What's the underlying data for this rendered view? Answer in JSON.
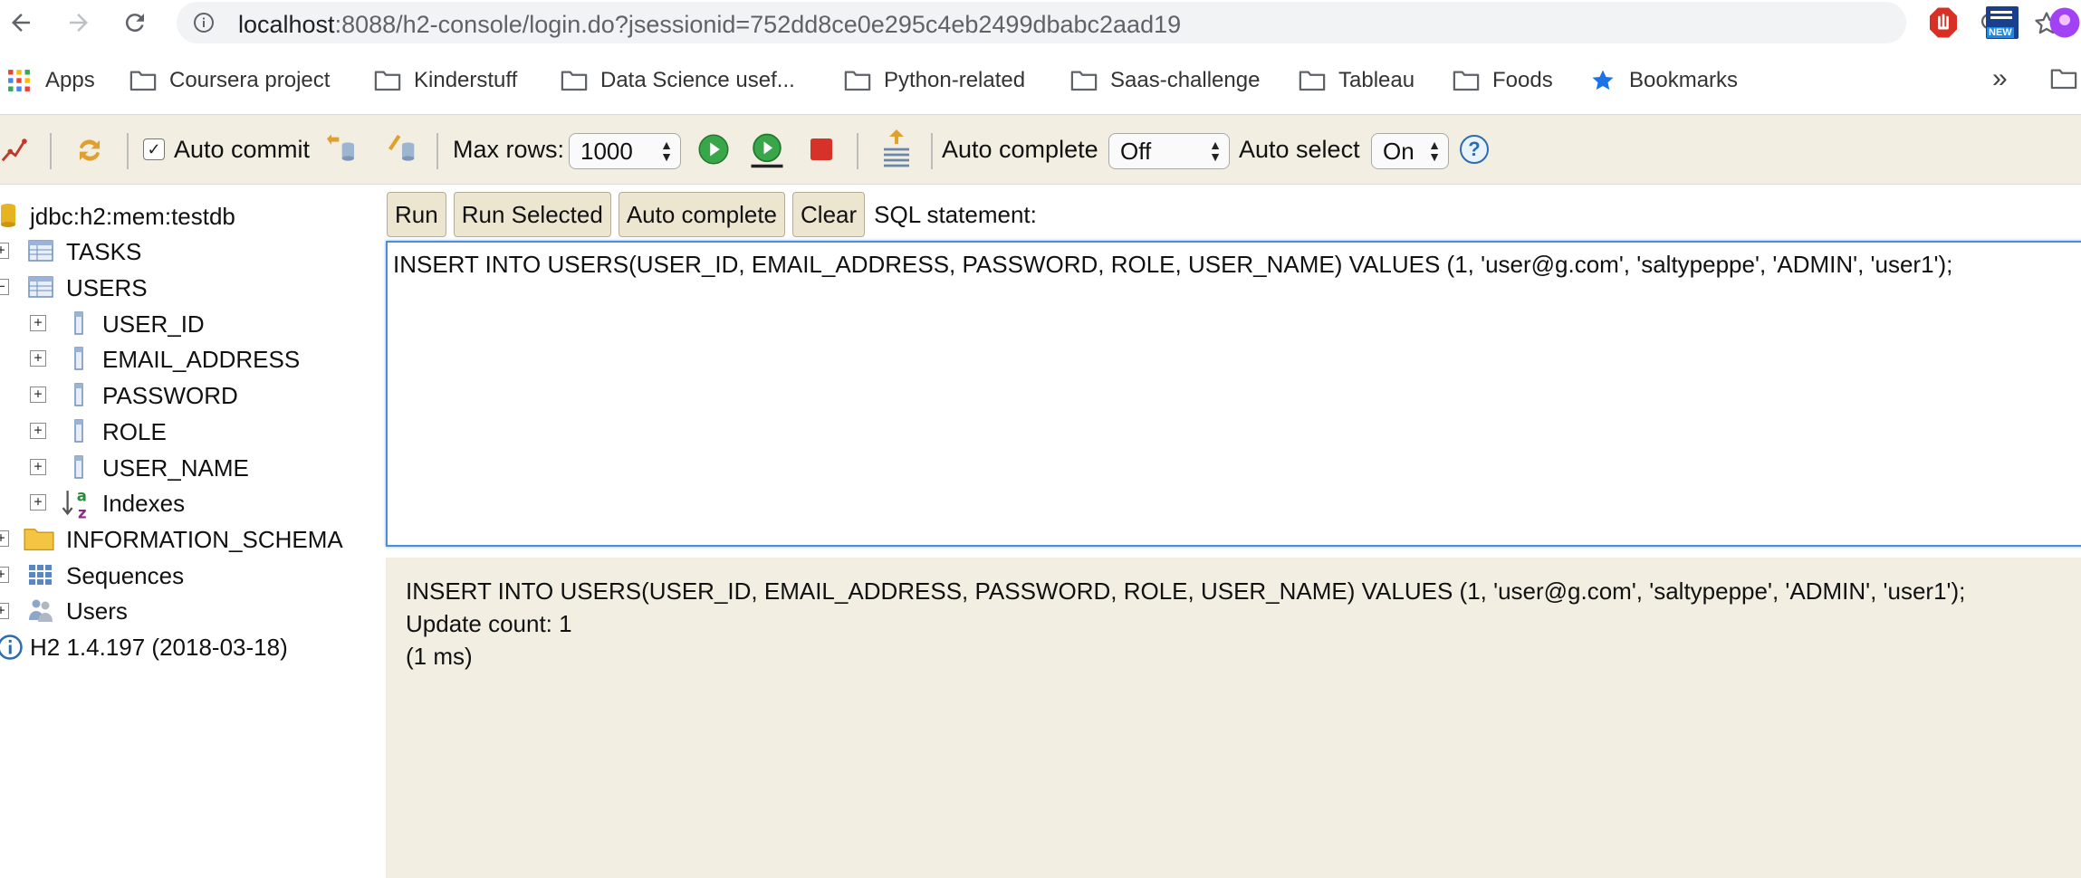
{
  "browser": {
    "url_host": "localhost",
    "url_rest": ":8088/h2-console/login.do?jsessionid=752dd8ce0e295c4eb2499dbabc2aad19",
    "extension_badge": "NEW"
  },
  "bookmarks": [
    {
      "label": "Apps",
      "icon": "apps-grid-icon"
    },
    {
      "label": "Coursera project",
      "icon": "folder-icon"
    },
    {
      "label": "Kinderstuff",
      "icon": "folder-icon"
    },
    {
      "label": "Data Science usef...",
      "icon": "folder-icon"
    },
    {
      "label": "Python-related",
      "icon": "folder-icon"
    },
    {
      "label": "Saas-challenge",
      "icon": "folder-icon"
    },
    {
      "label": "Tableau",
      "icon": "folder-icon"
    },
    {
      "label": "Foods",
      "icon": "folder-icon"
    },
    {
      "label": "Bookmarks",
      "icon": "star-icon"
    }
  ],
  "bookmarks_more": "»",
  "toolbar": {
    "auto_commit_label": "Auto commit",
    "auto_commit_checked": true,
    "max_rows_label": "Max rows:",
    "max_rows_value": "1000",
    "auto_complete_label": "Auto complete",
    "auto_complete_value": "Off",
    "auto_select_label": "Auto select",
    "auto_select_value": "On",
    "help_symbol": "?"
  },
  "tree": {
    "connection": "jdbc:h2:mem:testdb",
    "tables": [
      {
        "name": "TASKS",
        "expanded": false
      },
      {
        "name": "USERS",
        "expanded": true
      }
    ],
    "users_columns": [
      "USER_ID",
      "EMAIL_ADDRESS",
      "PASSWORD",
      "ROLE",
      "USER_NAME"
    ],
    "indexes_label": "Indexes",
    "information_schema": "INFORMATION_SCHEMA",
    "sequences": "Sequences",
    "users": "Users",
    "version": "H2 1.4.197 (2018-03-18)"
  },
  "query": {
    "buttons": {
      "run": "Run",
      "run_selected": "Run Selected",
      "auto_complete": "Auto complete",
      "clear": "Clear"
    },
    "sql_label": "SQL statement:",
    "editor_text": "INSERT INTO USERS(USER_ID, EMAIL_ADDRESS, PASSWORD, ROLE, USER_NAME) VALUES (1, 'user@g.com', 'saltypeppe', 'ADMIN', 'user1');"
  },
  "result": {
    "statement": "INSERT INTO USERS(USER_ID, EMAIL_ADDRESS, PASSWORD, ROLE, USER_NAME) VALUES (1, 'user@g.com', 'saltypeppe', 'ADMIN', 'user1');",
    "update_count": "Update count: 1",
    "time": "(1 ms)"
  },
  "colors": {
    "toolbar_bg": "#f2efe2",
    "editor_border": "#4a8fdd",
    "button_bg": "#ece5d0",
    "folder_outline": "#5f6368",
    "bookmark_star": "#1a73e8"
  }
}
